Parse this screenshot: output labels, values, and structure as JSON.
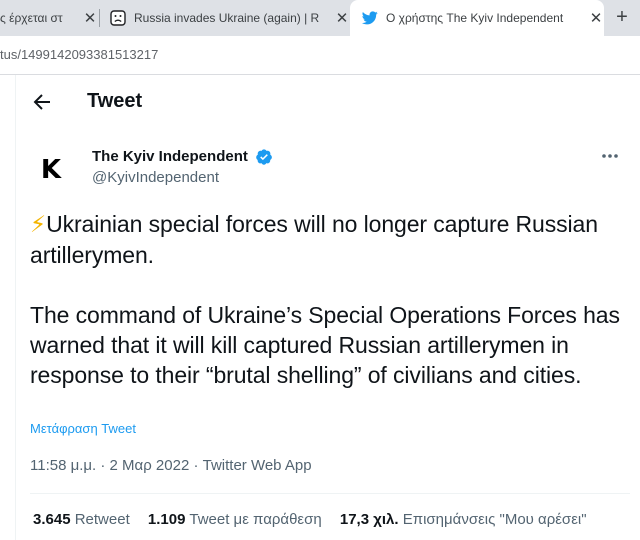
{
  "browser": {
    "tabs": [
      {
        "title": "ς έρχεται στ",
        "close": "✕"
      },
      {
        "title": "Russia invades Ukraine (again) | R",
        "close": "✕"
      },
      {
        "title": "Ο χρήστης The Kyiv Independent",
        "close": "✕",
        "active": true
      }
    ],
    "new_tab": "+",
    "url": "tus/1499142093381513217"
  },
  "header": {
    "title": "Tweet"
  },
  "tweet": {
    "avatar_letter": "K",
    "author_name": "The Kyiv Independent",
    "handle": "@KyivIndependent",
    "bolt": "⚡",
    "paragraph1": "Ukrainian special forces will no longer capture Russian artillerymen.",
    "paragraph2": "The command of Ukraine’s Special Operations Forces has warned that it will kill captured Russian artillerymen in response to their “brutal shelling” of civilians and cities.",
    "translate": "Μετάφραση Tweet",
    "meta": "11:58 μ.μ. · 2 Μαρ 2022 · Twitter Web App"
  },
  "stats": {
    "retweets_count": "3.645",
    "retweets_label": "Retweet",
    "quotes_count": "1.109",
    "quotes_label": "Tweet με παράθεση",
    "likes_count": "17,3 χιλ.",
    "likes_label": "Επισημάνσεις \"Μου αρέσει\""
  },
  "colors": {
    "accent": "#1d9bf0",
    "text": "#0f1419",
    "secondary": "#536471",
    "bolt": "#f4b400"
  }
}
